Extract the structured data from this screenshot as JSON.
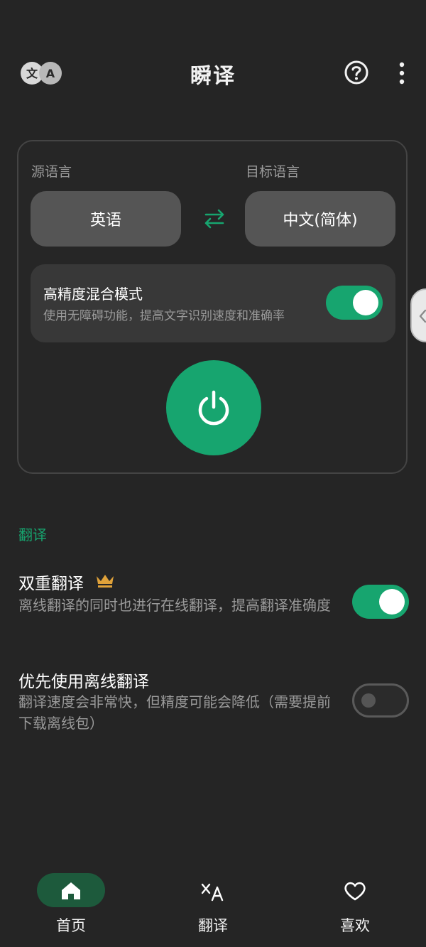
{
  "app": {
    "title": "瞬译",
    "logo_icon": "translate-logo-icon",
    "logo_letters": [
      "文",
      "A"
    ],
    "header_icons": [
      "help-circle-icon",
      "more-vert-icon"
    ]
  },
  "language_panel": {
    "source_label": "源语言",
    "target_label": "目标语言",
    "source_value": "英语",
    "target_value": "中文(简体)",
    "swap_icon": "swap-arrows-icon"
  },
  "high_precision": {
    "title": "高精度混合模式",
    "description": "使用无障碍功能，提高文字识别速度和准确率",
    "enabled": true
  },
  "power_icon": "power-icon",
  "settings": {
    "section_title": "翻译",
    "items": [
      {
        "title": "双重翻译",
        "badge_icon": "crown-icon",
        "description": "离线翻译的同时也进行在线翻译，提高翻译准确度",
        "enabled": true
      },
      {
        "title": "优先使用离线翻译",
        "description": "翻译速度会非常快，但精度可能会降低（需要提前下载离线包）",
        "enabled": false
      }
    ]
  },
  "bottom_nav": {
    "items": [
      {
        "label": "首页",
        "icon": "home-icon",
        "active": true
      },
      {
        "label": "翻译",
        "icon": "translate-icon",
        "active": false
      },
      {
        "label": "喜欢",
        "icon": "heart-icon",
        "active": false
      }
    ]
  },
  "colors": {
    "background": "#252525",
    "accent": "#17a56f",
    "crown": "#e0a23a"
  }
}
